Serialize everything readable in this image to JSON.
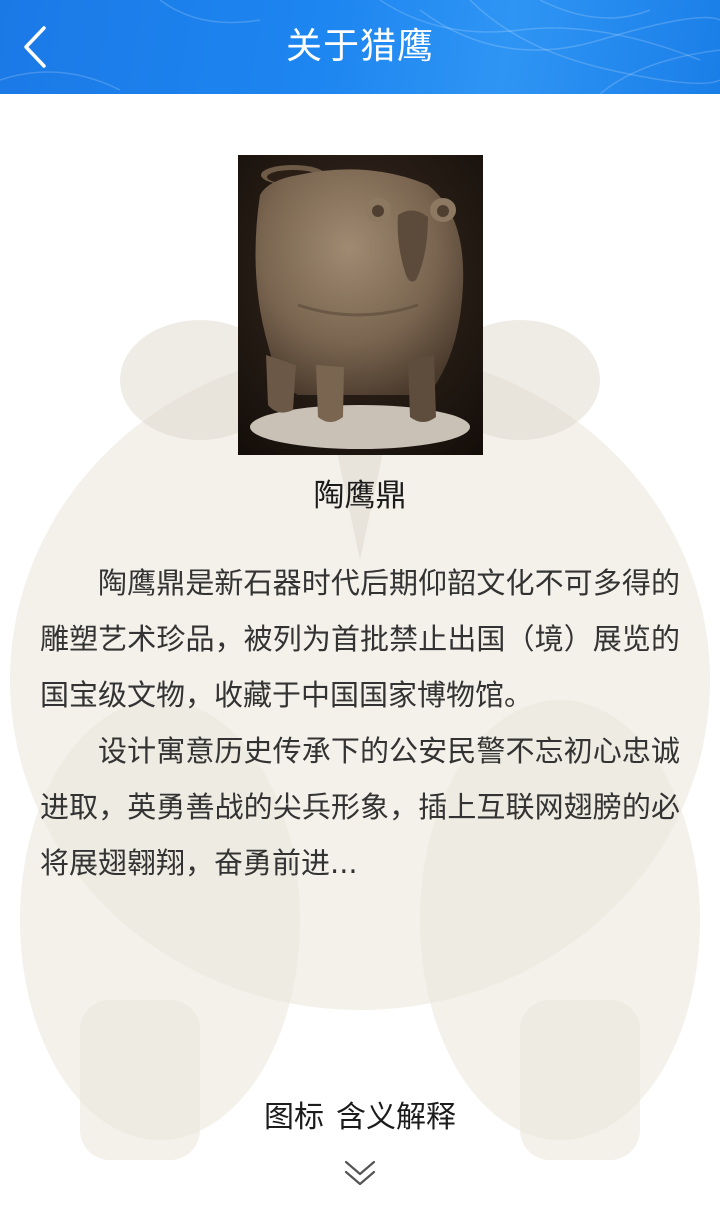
{
  "header": {
    "title": "关于猎鹰",
    "back_icon": "chevron-left-icon",
    "background_color": "#1d86f0"
  },
  "artifact": {
    "image": "pottery-eagle-tripod-photo",
    "name": "陶鹰鼎"
  },
  "description": {
    "paragraphs": [
      "陶鹰鼎是新石器时代后期仰韶文化不可多得的雕塑艺术珍品，被列为首批禁止出国（境）展览的国宝级文物，收藏于中国国家博物馆。",
      "设计寓意历史传承下的公安民警不忘初心忠诚进取，英勇善战的尖兵形象，插上互联网翅膀的必将展翅翱翔，奋勇前进..."
    ]
  },
  "footer": {
    "explain_word1": "图标",
    "explain_word2": "含义解释",
    "expand_icon": "double-chevron-down-icon"
  }
}
